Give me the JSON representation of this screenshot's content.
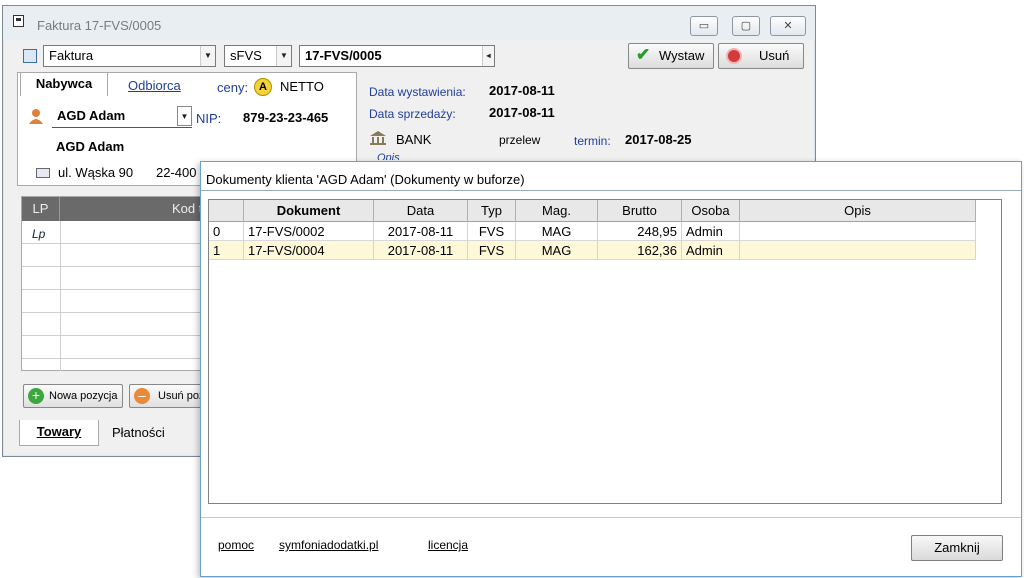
{
  "main_window": {
    "title": "Faktura 17-FVS/0005",
    "doc_type": "Faktura",
    "series": "sFVS",
    "number": "17-FVS/0005",
    "buttons": {
      "issue": "Wystaw",
      "delete": "Usuń"
    },
    "tabs": {
      "buyer": "Nabywca",
      "recipient": "Odbiorca"
    },
    "prices_label": "ceny:",
    "prices_badge": "A",
    "prices_value": "NETTO",
    "buyer": {
      "short_name": "AGD Adam",
      "nip_label": "NIP:",
      "nip": "879-23-23-465",
      "full_name": "AGD Adam",
      "address": "ul. Wąska 90",
      "postal": "22-400"
    },
    "dates": {
      "issue_label": "Data wystawienia:",
      "issue_value": "2017-08-11",
      "sale_label": "Data sprzedaży:",
      "sale_value": "2017-08-11"
    },
    "payment": {
      "bank": "BANK",
      "method": "przelew",
      "due_label": "termin:",
      "due_value": "2017-08-25",
      "desc_partial": "Opis"
    },
    "items_grid": {
      "col_lp": "LP",
      "col_code_partial": "Kod t",
      "row_marker": "Lp"
    },
    "item_buttons": {
      "add": "Nowa pozycja",
      "remove_partial": "Usuń poz"
    },
    "bottom_tabs": {
      "goods": "Towary",
      "payments": "Płatności"
    }
  },
  "dialog": {
    "title": "Dokumenty klienta 'AGD Adam' (Dokumenty w buforze)",
    "columns": [
      "",
      "Dokument",
      "Data",
      "Typ",
      "Mag.",
      "Brutto",
      "Osoba",
      "Opis"
    ],
    "rows": [
      {
        "idx": "0",
        "doc": "17-FVS/0002",
        "date": "2017-08-11",
        "type": "FVS",
        "mag": "MAG",
        "gross": "248,95",
        "person": "Admin",
        "desc": ""
      },
      {
        "idx": "1",
        "doc": "17-FVS/0004",
        "date": "2017-08-11",
        "type": "FVS",
        "mag": "MAG",
        "gross": "162,36",
        "person": "Admin",
        "desc": ""
      }
    ],
    "links": {
      "help": "pomoc",
      "site": "symfoniadodatki.pl",
      "license": "licencja"
    },
    "close_button": "Zamknij"
  },
  "colors": {
    "selected_row": "#fdf8d8",
    "accent_green": "#2a9a2a",
    "delete_red": "#d23b3b"
  }
}
